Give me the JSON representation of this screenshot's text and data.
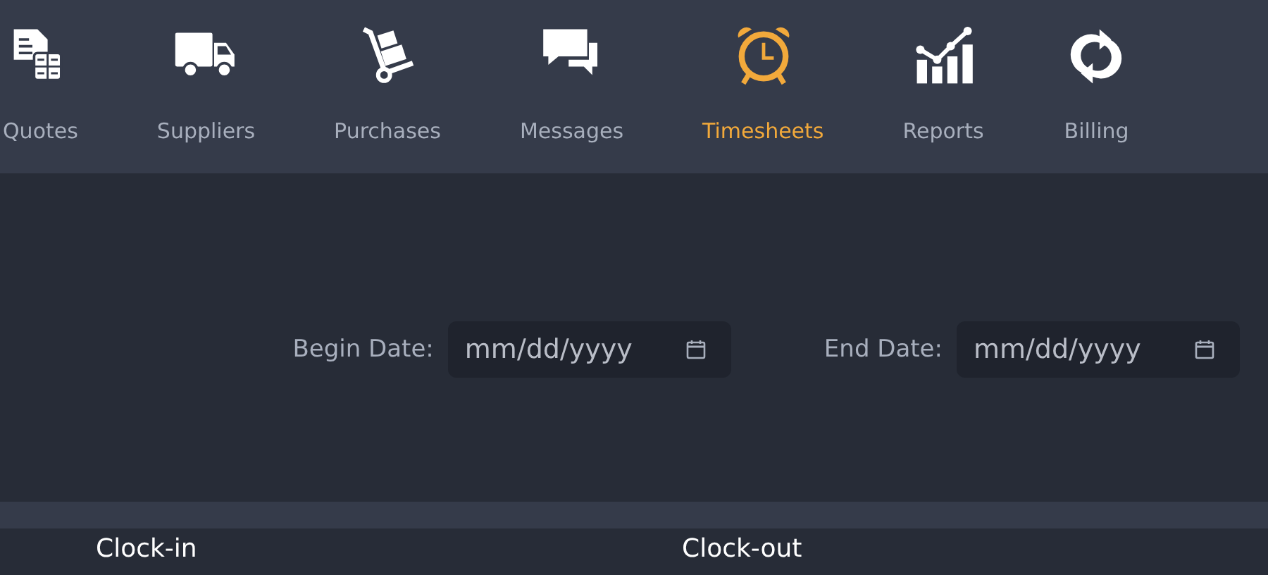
{
  "nav": {
    "items": [
      {
        "label": "Quotes",
        "selected": false
      },
      {
        "label": "Suppliers",
        "selected": false
      },
      {
        "label": "Purchases",
        "selected": false
      },
      {
        "label": "Messages",
        "selected": false
      },
      {
        "label": "Timesheets",
        "selected": true
      },
      {
        "label": "Reports",
        "selected": false
      },
      {
        "label": "Billing",
        "selected": false
      }
    ]
  },
  "filters": [
    {
      "label": "Begin Date:",
      "placeholder": "mm/dd/yyyy"
    },
    {
      "label": "End Date:",
      "placeholder": "mm/dd/yyyy"
    }
  ],
  "table": {
    "columns": [
      "Clock-in",
      "Clock-out"
    ]
  }
}
